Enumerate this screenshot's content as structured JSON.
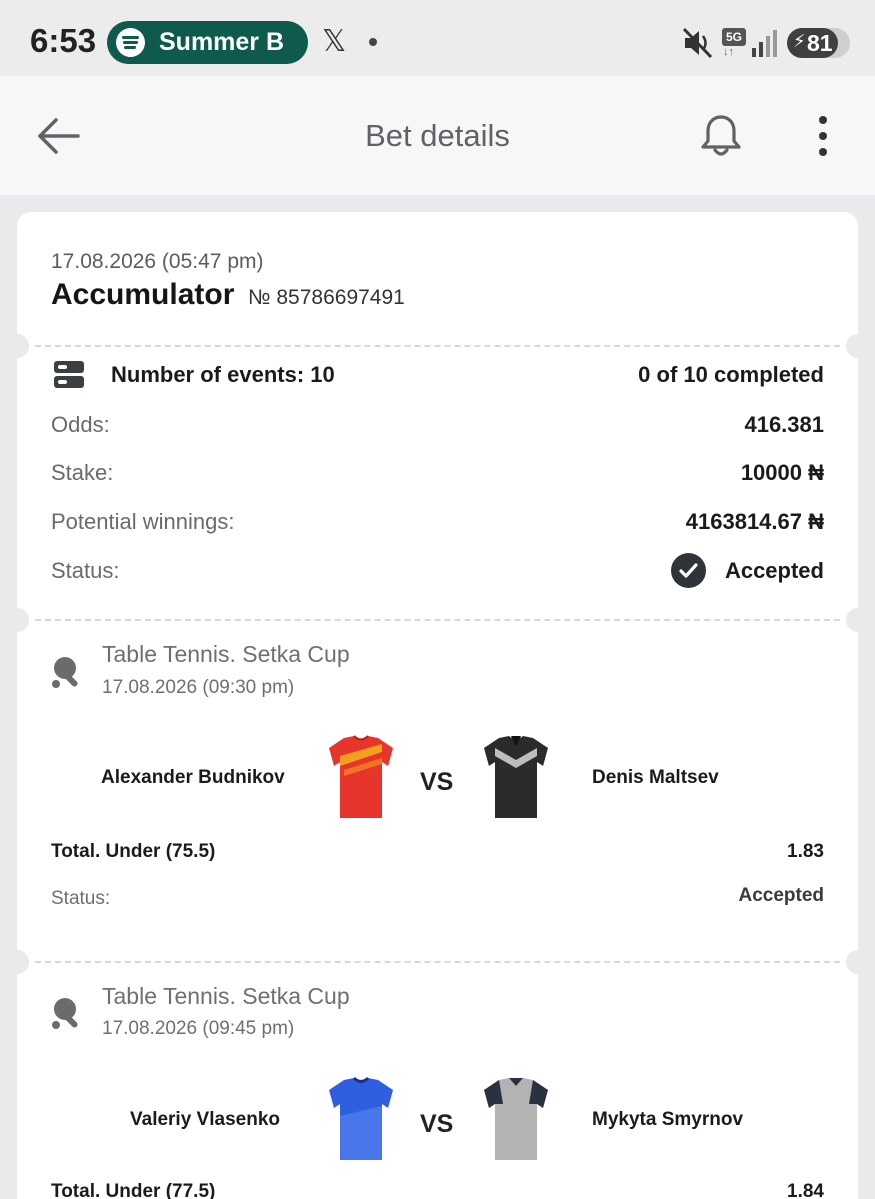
{
  "status_bar": {
    "time": "6:53",
    "media_pill_text": "Summer B",
    "network": "5G",
    "battery": "81",
    "battery_level": 0.81
  },
  "app_bar": {
    "title": "Bet details",
    "back_icon": "arrow-left-icon",
    "bell_icon": "bell-icon",
    "more_icon": "more-vertical-icon"
  },
  "bet": {
    "date": "17.08.2026 (05:47 pm)",
    "type": "Accumulator",
    "number": "№ 85786697491",
    "events_label": "Number of events: 10",
    "completed": "0 of 10 completed",
    "odds_label": "Odds:",
    "odds_value": "416.381",
    "stake_label": "Stake:",
    "stake_value": "10000 ₦",
    "winnings_label": "Potential winnings:",
    "winnings_value": "4163814.67 ₦",
    "status_label": "Status:",
    "status_value": "Accepted"
  },
  "events": [
    {
      "league": "Table Tennis. Setka Cup",
      "date": "17.08.2026 (09:30 pm)",
      "home": "Alexander Budnikov",
      "away": "Denis Maltsev",
      "vs": "VS",
      "market": "Total. Under (75.5)",
      "odd": "1.83",
      "status_label": "Status:",
      "status_value": "Accepted"
    },
    {
      "league": "Table Tennis. Setka Cup",
      "date": "17.08.2026 (09:45 pm)",
      "home": "Valeriy Vlasenko",
      "away": "Mykyta Smyrnov",
      "vs": "VS",
      "market": "Total. Under (77.5)",
      "odd": "1.84"
    }
  ],
  "colors": {
    "accent_dark": "#2f3438",
    "spotify_pill": "#0e5a4c",
    "jersey_red": "#e8352c",
    "jersey_blue": "#2f5fe0"
  }
}
